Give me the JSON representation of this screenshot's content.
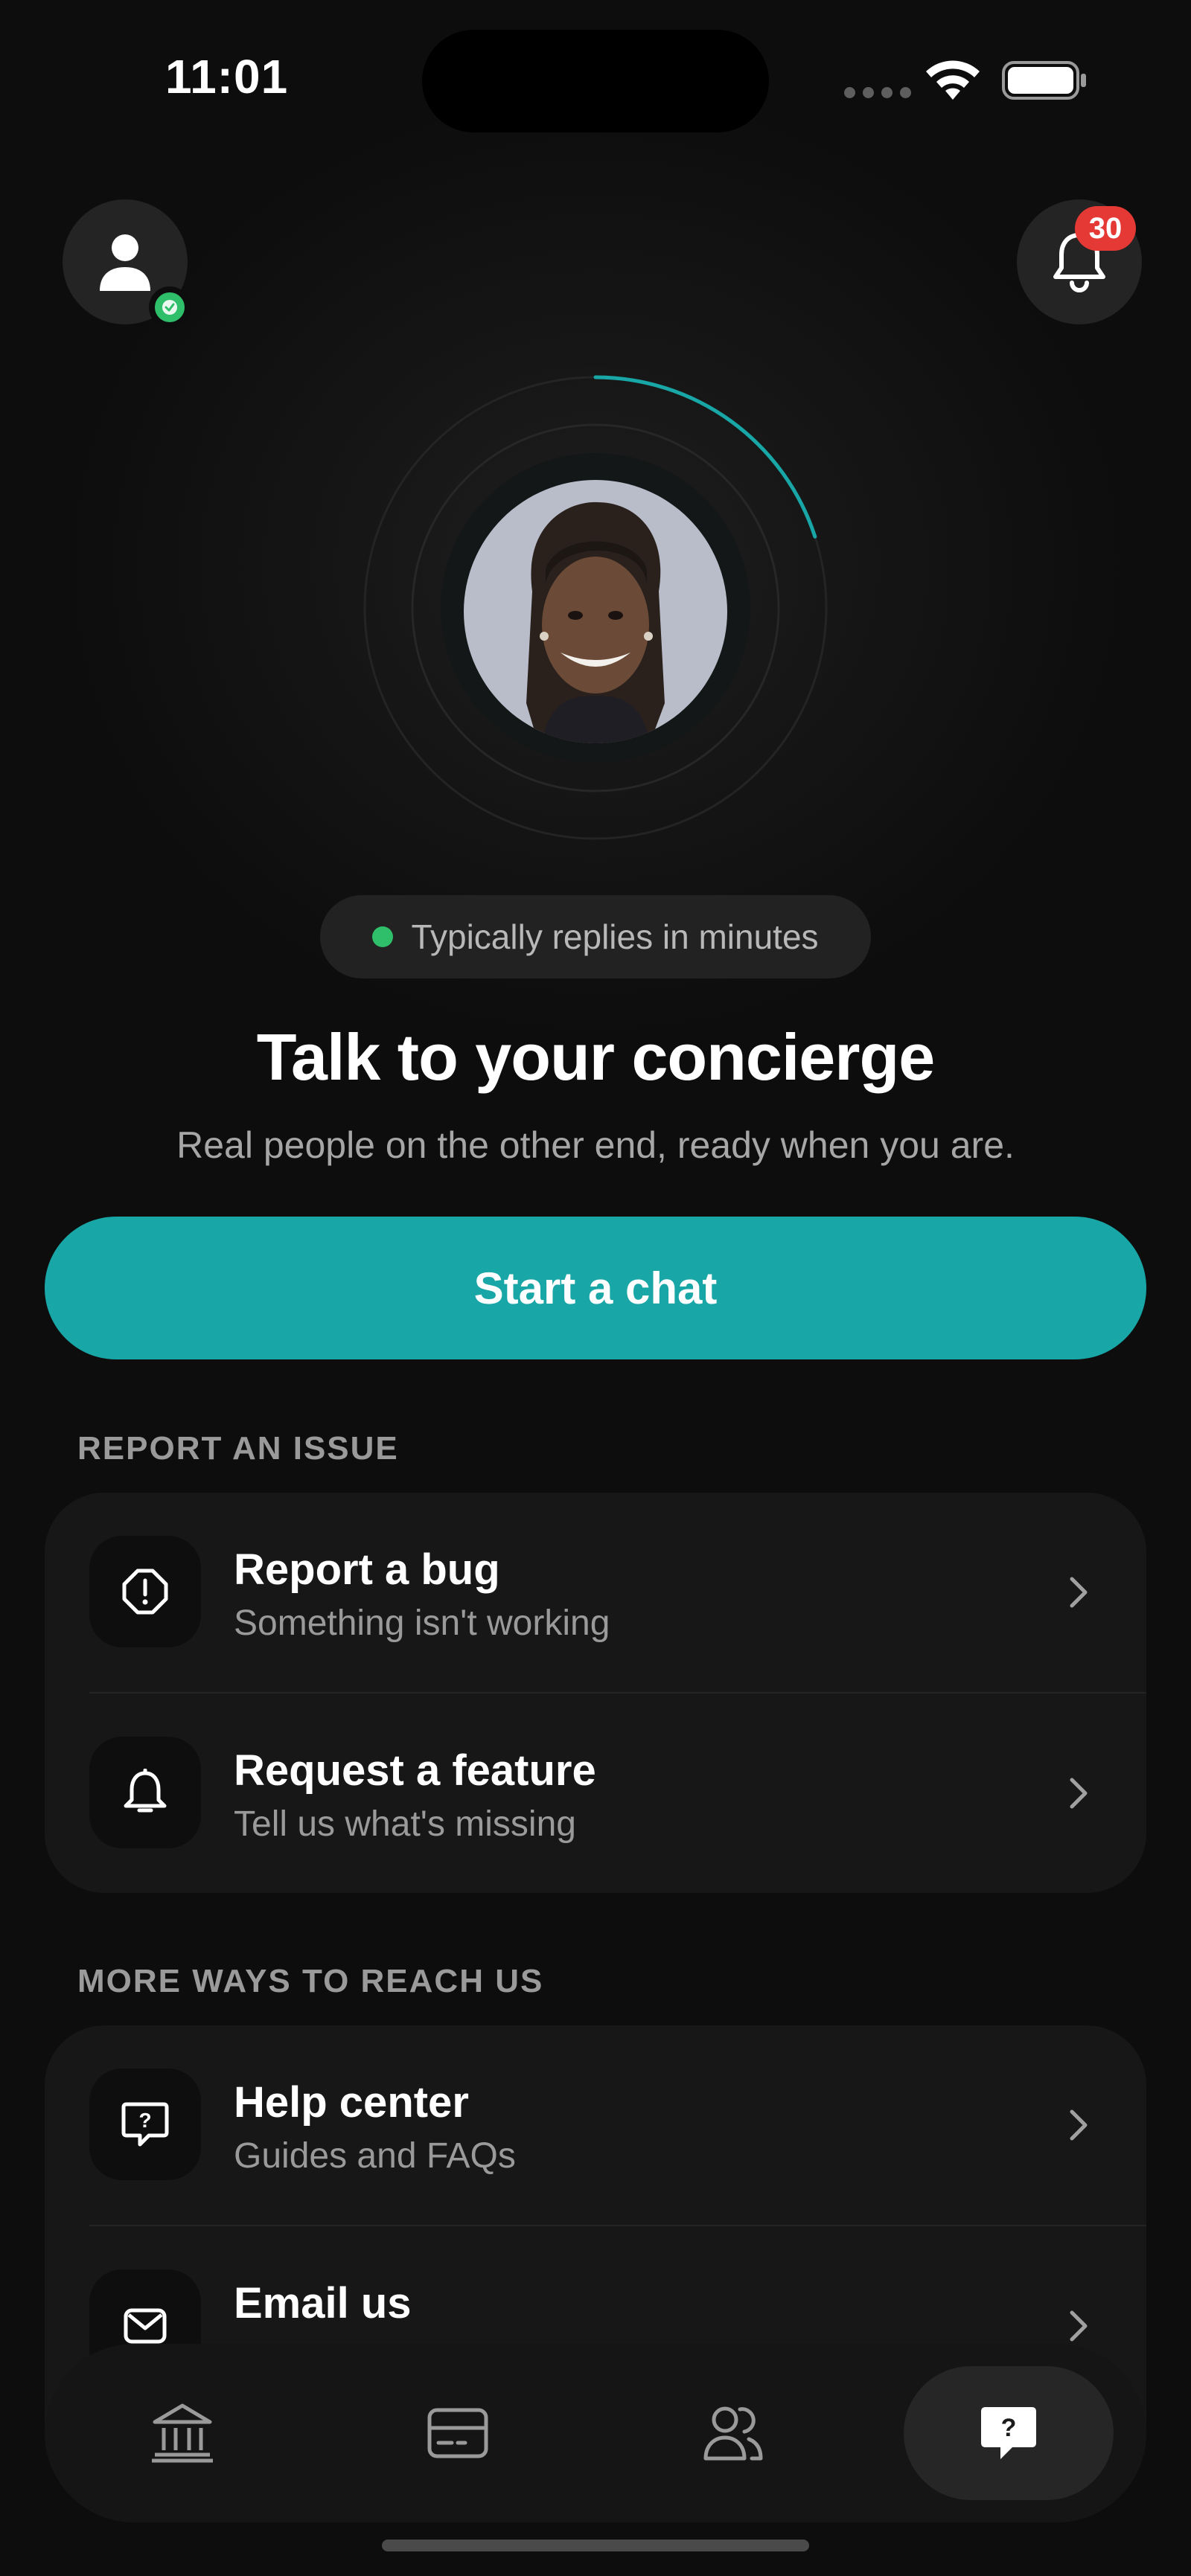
{
  "status_bar": {
    "time": "11:01",
    "icons": [
      "cellular-signal-icon",
      "wifi-icon",
      "battery-icon"
    ]
  },
  "header": {
    "profile_icon": "person-icon",
    "verified_badge_icon": "check-icon",
    "notifications_icon": "bell-icon",
    "notification_count": "30"
  },
  "concierge": {
    "status_text": "Typically replies in minutes",
    "status_color": "#2fbf6a",
    "progress_ring_color": "#18a6a6",
    "progress_fraction": 0.2,
    "title": "Talk to your concierge",
    "subtitle": "Real people on the other end, ready when you are.",
    "cta_label": "Start a chat",
    "accent_color": "#18a6a6"
  },
  "report_section": {
    "label": "REPORT AN ISSUE",
    "items": [
      {
        "title": "Report a bug",
        "subtitle": "Something isn't working",
        "icon": "alert-octagon-icon"
      },
      {
        "title": "Request a feature",
        "subtitle": "Tell us what's missing",
        "icon": "bell-outline-icon"
      }
    ]
  },
  "more_section": {
    "label": "MORE WAYS TO REACH US",
    "items": [
      {
        "title": "Help center",
        "subtitle": "Guides and FAQs",
        "icon": "question-bubble-icon"
      },
      {
        "title": "Email us",
        "icon": "mail-icon"
      }
    ]
  },
  "tab_bar": {
    "tabs": [
      {
        "icon": "bank-icon",
        "active": false
      },
      {
        "icon": "card-icon",
        "active": false
      },
      {
        "icon": "people-icon",
        "active": false
      },
      {
        "icon": "help-chat-icon",
        "active": true
      }
    ]
  }
}
